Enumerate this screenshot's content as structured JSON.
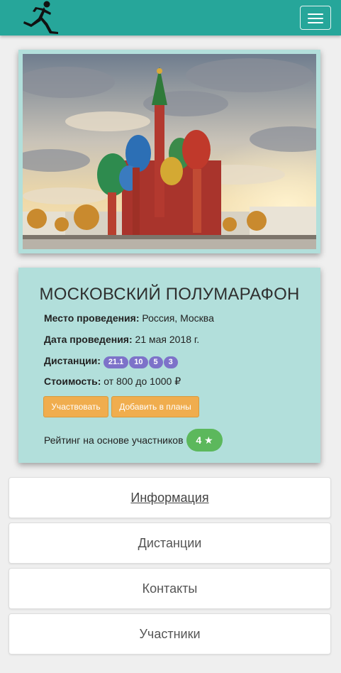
{
  "event": {
    "title": "МОСКОВСКИЙ ПОЛУМАРАФОН",
    "venue_label": "Место проведения:",
    "venue_value": "Россия, Москва",
    "date_label": "Дата проведения:",
    "date_value": "21 мая 2018 г.",
    "distances_label": "Дистанции:",
    "distances": [
      "21.1",
      "10",
      "5",
      "3"
    ],
    "price_label": "Стоимость:",
    "price_value": "от 800 до 1000 ₽",
    "participate_button": "Участвовать",
    "add_plans_button": "Добавить в планы",
    "rating_label": "Рейтинг на основе участников",
    "rating_value": "4 ★"
  },
  "tabs": [
    {
      "label": "Информация",
      "active": true
    },
    {
      "label": "Дистанции",
      "active": false
    },
    {
      "label": "Контакты",
      "active": false
    },
    {
      "label": "Участники",
      "active": false
    }
  ],
  "colors": {
    "navbar": "#26a69a",
    "card": "#b2dfdb",
    "badge": "#7d72c9",
    "button": "#f0ad4e",
    "rating": "#5cb85c"
  },
  "icons": {
    "logo": "runner-logo-icon",
    "menu": "hamburger-menu-icon",
    "rating": "star-icon"
  }
}
